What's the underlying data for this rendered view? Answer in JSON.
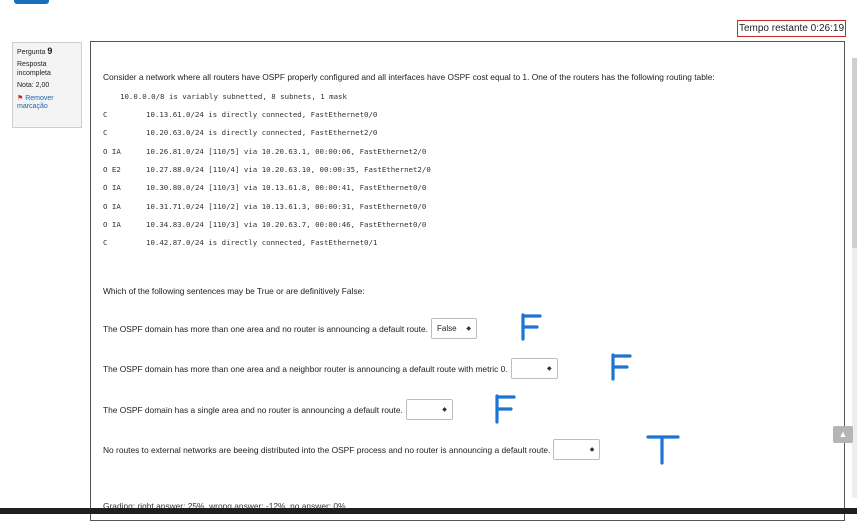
{
  "timer": "Tempo restante 0:26:19",
  "question_info": {
    "label": "Pergunta",
    "number": "9",
    "status": "Resposta incompleta",
    "grade": "Nota: 2,00",
    "flag_label": "Remover marcação"
  },
  "question": {
    "intro": "Consider a network where all routers have OSPF properly configured and all interfaces have OSPF cost equal to 1. One of the routers has the following routing table:",
    "table_header": "10.0.0.0/8 is variably subnetted, 8 subnets, 1 mask",
    "routes": [
      {
        "code": "C",
        "desc": "10.13.61.0/24 is directly connected, FastEthernet0/0"
      },
      {
        "code": "C",
        "desc": "10.20.63.0/24 is directly connected, FastEthernet2/0"
      },
      {
        "code": "O IA",
        "desc": "10.26.81.0/24 [110/5] via 10.20.63.1, 00:00:06, FastEthernet2/0"
      },
      {
        "code": "O E2",
        "desc": "10.27.88.0/24 [110/4] via 10.20.63.10, 00:00:35, FastEthernet2/0"
      },
      {
        "code": "O IA",
        "desc": "10.30.80.0/24 [110/3] via 10.13.61.8, 00:00:41, FastEthernet0/0"
      },
      {
        "code": "O IA",
        "desc": "10.31.71.0/24 [110/2] via 10.13.61.3, 00:00:31, FastEthernet0/0"
      },
      {
        "code": "O IA",
        "desc": "10.34.83.0/24 [110/3] via 10.20.63.7, 00:00:46, FastEthernet0/0"
      },
      {
        "code": "C",
        "desc": "10.42.87.0/24 is directly connected, FastEthernet0/1"
      }
    ],
    "prompt": "Which of the following sentences may be True or are definitively False:",
    "statements": [
      {
        "text": "The OSPF domain has more than one area and no router is announcing a default route.",
        "selected": "False"
      },
      {
        "text": "The OSPF domain has more than one area and a neighbor router is announcing a default route with metric 0.",
        "selected": ""
      },
      {
        "text": "The OSPF domain has a single area and no router is announcing a default route.",
        "selected": ""
      },
      {
        "text": "No routes to external networks are beeing distributed into the OSPF process and no router is announcing a default route.",
        "selected": ""
      }
    ],
    "grading": "Grading: right answer: 25%, wrong answer: -12%, no answer: 0%"
  },
  "annotations": [
    "F",
    "F",
    "F",
    "T"
  ],
  "colors": {
    "accent": "#1670bd",
    "timer_border": "#c62828",
    "annotation": "#1b74d6"
  },
  "icons": {
    "flag": "flag-icon",
    "select_arrow": "updown-arrow-icon",
    "scroll_up": "chevron-up-icon"
  }
}
